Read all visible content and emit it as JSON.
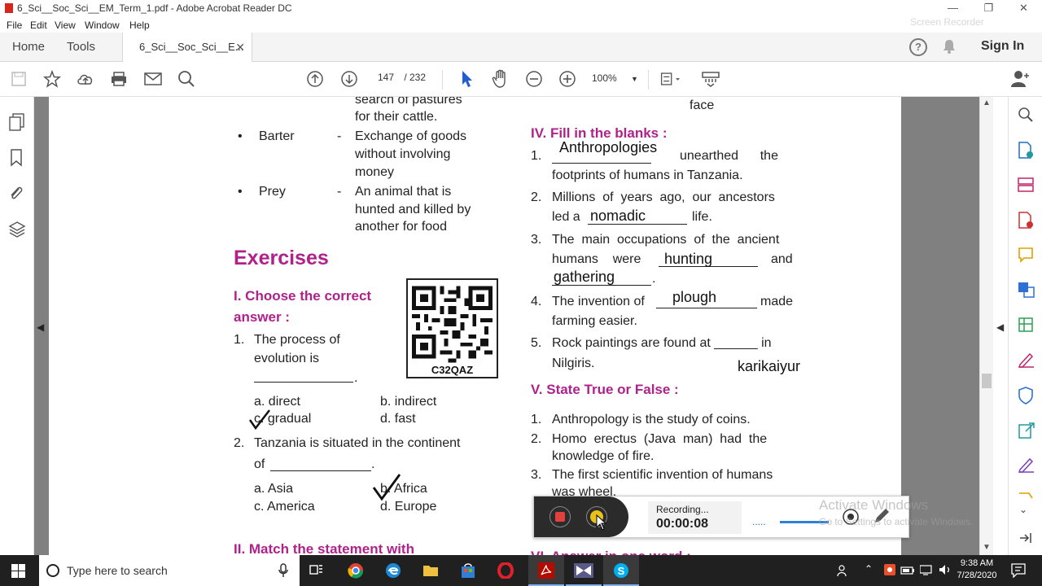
{
  "window": {
    "title": "6_Sci__Soc_Sci__EM_Term_1.pdf - Adobe Acrobat Reader DC"
  },
  "menu": [
    "File",
    "Edit",
    "View",
    "Window",
    "Help"
  ],
  "tabs": {
    "home": "Home",
    "tools": "Tools",
    "doc": "6_Sci__Soc_Sci__E..."
  },
  "signin": "Sign In",
  "toolbar": {
    "page_current": "147",
    "page_total": "/  232",
    "zoom": "100%"
  },
  "page": {
    "top_frag1": "search of pastures",
    "top_frag2": "for their cattle.",
    "top_right_frag": "face",
    "gloss": [
      {
        "term": "Barter",
        "dash": "-",
        "def": [
          "Exchange of goods",
          "without involving",
          "money"
        ]
      },
      {
        "term": "Prey",
        "dash": "-",
        "def": [
          "An animal that is",
          "hunted and killed by",
          "another for food"
        ]
      }
    ],
    "exercises": "Exercises",
    "sec1": [
      "I. Choose the correct",
      "answer :"
    ],
    "qr_code": "C32QAZ",
    "q1": {
      "n": "1.",
      "text": [
        "The process of",
        "evolution is"
      ],
      "end": ".",
      "a": "a. direct",
      "b": "b. indirect",
      "c": "c. gradual",
      "d": "d. fast"
    },
    "q2": {
      "n": "2.",
      "text": "Tanzania  is  situated  in  the  continent",
      "of": "of",
      "end": ".",
      "a": "a. Asia",
      "b": "b. Africa",
      "c": "c. America",
      "d": "d. Europe"
    },
    "sec2": "II. Match the statement with",
    "sec4": "IV. Fill in the blanks :",
    "fill": [
      {
        "n": "1.",
        "ans": "Anthropologies",
        "after": "unearthed      the",
        "line2": "footprints of humans in Tanzania."
      },
      {
        "n": "2.",
        "line1": "Millions  of  years  ago,  our  ancestors",
        "before": "led a",
        "ans": "nomadic",
        "after": "life."
      },
      {
        "n": "3.",
        "line1": "The  main  occupations  of  the  ancient",
        "before": "humans    were",
        "ans": "hunting",
        "after": "and",
        "ans2": "gathering",
        "end": "."
      },
      {
        "n": "4.",
        "before": "The invention of",
        "ans": "plough",
        "after": "made",
        "line2": "farming easier."
      },
      {
        "n": "5.",
        "line1": "Rock paintings are found at ______ in",
        "line2": "Nilgiris.",
        "ans": "karikaiyur"
      }
    ],
    "sec5": "V. State True or False :",
    "tf": [
      {
        "n": "1.",
        "text": "Anthropology is the study of coins."
      },
      {
        "n": "2.",
        "text": "Homo  erectus  (Java  man)  had  the",
        "text2": "knowledge of fire."
      },
      {
        "n": "3.",
        "text": "The first scientific invention of humans",
        "text2": "was wheel."
      }
    ],
    "sec6": "VI. Answer in one word :"
  },
  "recorder": {
    "status": "Recording...",
    "time": "00:00:08",
    "dots": "....."
  },
  "watermark": {
    "line1": "Activate Windows",
    "line2": "Go to Settings to activate Windows.",
    "rec_brand": "Screen Recorder"
  },
  "taskbar": {
    "search_placeholder": "Type here to search",
    "time": "9:38 AM",
    "date": "7/28/2020"
  }
}
